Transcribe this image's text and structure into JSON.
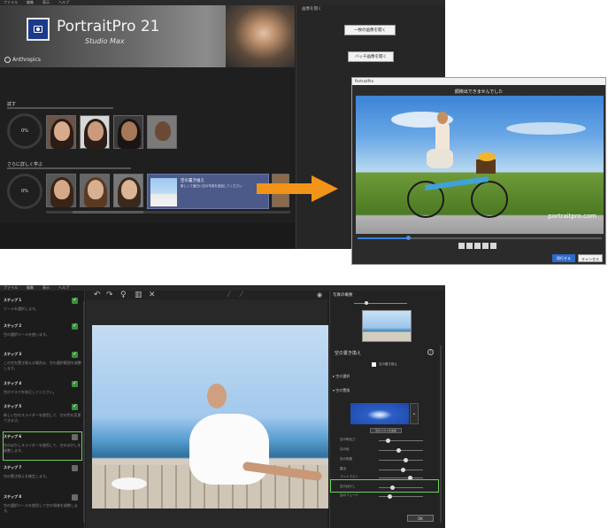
{
  "top": {
    "menu": [
      "ファイル",
      "編集",
      "表示",
      "ヘルプ"
    ],
    "title": "PortraitPro 21",
    "subtitle": "Studio Max",
    "brand": "Anthropics",
    "side_panel_title": "画像を開く",
    "open_single_button": "一枚の画像を開く",
    "open_batch_button": "バッチ画像を開く",
    "section1_heading": "試す",
    "section1_percent": "0%",
    "section2_heading": "さらに詳しく学ぶ",
    "section2_percent": "0%",
    "tutorial_card_title": "空の置き換え",
    "tutorial_card_text": "新しくて面白い空の写真を追加してください"
  },
  "dialog": {
    "window_title": "PortraitPro",
    "heading": "顔検出できませんでした",
    "watermark": "portraitpro.com",
    "continue_button": "続行する",
    "cancel_button": "キャンセル"
  },
  "bottom": {
    "menu": [
      "ファイル",
      "編集",
      "表示",
      "ヘルプ"
    ],
    "steps": [
      {
        "title": "ステップ 1",
        "text": "ツールを選択します。"
      },
      {
        "title": "ステップ 2",
        "text": "空の選択ツールを使います。"
      },
      {
        "title": "ステップ 3",
        "text": "この空を置き換える場合は、空の選択範囲を調整します。"
      },
      {
        "title": "ステップ 4",
        "text": "空のマスクを修正してください。"
      },
      {
        "title": "ステップ 5",
        "text": "新しい空のスライダーを使用して、空の色を変更できます。"
      },
      {
        "title": "ステップ 6",
        "text": "空のぼかしスライダーを使用して、空のぼかしを調整します。"
      },
      {
        "title": "ステップ 7",
        "text": "空の置き換えを確定します。"
      },
      {
        "title": "ステップ 8",
        "text": "空の選択ツールを使用して空の領域を調整します。"
      }
    ],
    "right_panel_title": "写真の概要",
    "replace_sky_heading": "空の置き換え",
    "replace_sky_checkbox": "空の置き換え",
    "section_sky_select": "空の選択",
    "section_sky_replace": "空の置換",
    "choose_sky_button": "空のスカイを追加",
    "sliders": [
      {
        "label": "空の明るさ",
        "value": 0.2
      },
      {
        "label": "空の色",
        "value": 0.45
      },
      {
        "label": "空の彩度",
        "value": 0.6
      },
      {
        "label": "露出",
        "value": 0.55
      },
      {
        "label": "コントラスト",
        "value": 0.7
      },
      {
        "label": "空のぼかし",
        "value": 0.3
      },
      {
        "label": "空のフェード",
        "value": 0.25
      }
    ],
    "ok_button": "OK"
  },
  "colors": {
    "arrow": "#f29418",
    "highlight_green": "#6fcf5a",
    "link_blue": "#5aa0e6",
    "tutorial_card": "#4c5a8a",
    "primary_button": "#2d6ac8"
  }
}
